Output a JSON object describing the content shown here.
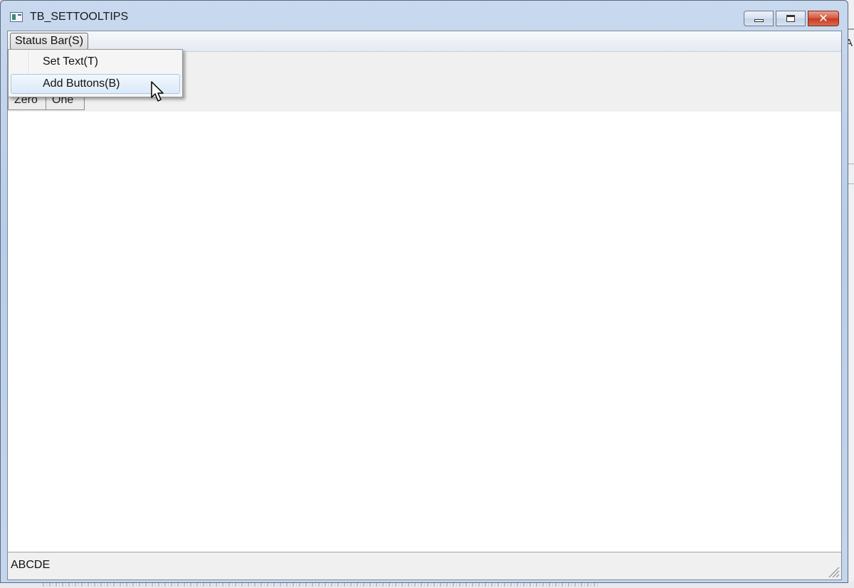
{
  "window": {
    "title": "TB_SETTOOLTIPS"
  },
  "menubar": {
    "status_bar_menu": "Status Bar(S)"
  },
  "popup_menu": {
    "items": [
      {
        "label": "Set Text(T)"
      },
      {
        "label": "Add Buttons(B)"
      }
    ]
  },
  "toolbar": {
    "buttons": [
      {
        "label": "Zero"
      },
      {
        "label": "One"
      }
    ]
  },
  "statusbar": {
    "text": "ABCDE"
  },
  "background": {
    "right_char": "A"
  },
  "colors": {
    "close_button": "#c43a22",
    "highlight_border": "#a8c8ea"
  }
}
